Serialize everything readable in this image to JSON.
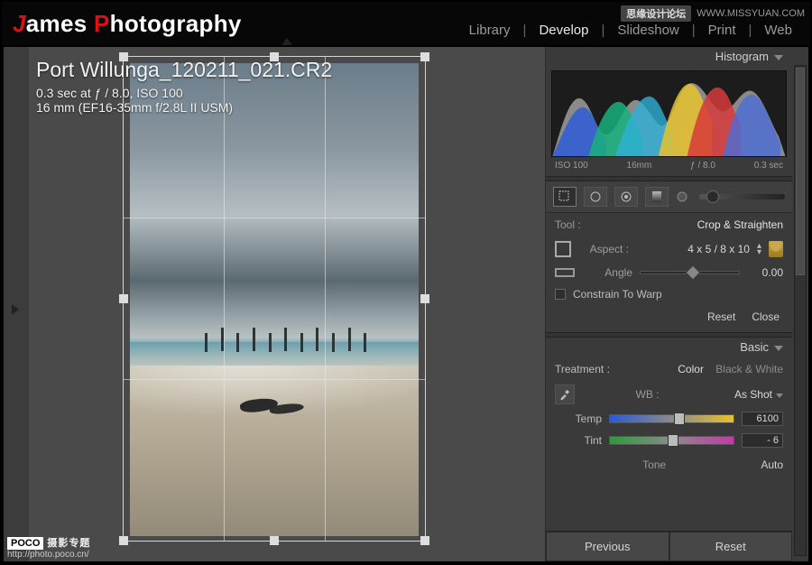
{
  "brand": {
    "pre": "ames ",
    "mid": "hotography"
  },
  "modules": {
    "library": "Library",
    "develop": "Develop",
    "slideshow": "Slideshow",
    "print": "Print",
    "web": "Web",
    "active": "develop"
  },
  "watermark_top": {
    "cn": "思缘设计论坛",
    "url": "WWW.MISSYUAN.COM"
  },
  "watermark_bottom": {
    "brand": "POCO",
    "cn": "摄影专题",
    "url": "http://photo.poco.cn/"
  },
  "image": {
    "filename": "Port Willunga_120211_021.CR2",
    "exposure_line": "0.3 sec at ƒ / 8.0, ISO 100",
    "lens_line": "16 mm (EF16-35mm f/2.8L II USM)"
  },
  "panels": {
    "histogram": {
      "title": "Histogram",
      "labels": {
        "iso": "ISO 100",
        "focal": "16mm",
        "aperture": "ƒ / 8.0",
        "shutter": "0.3 sec"
      }
    },
    "tool": {
      "label": "Tool :",
      "name": "Crop & Straighten",
      "aspect_label": "Aspect :",
      "aspect_value": "4 x 5  /  8 x 10",
      "angle_label": "Angle",
      "angle_value": "0.00",
      "constrain": "Constrain To Warp",
      "reset": "Reset",
      "close": "Close"
    },
    "basic": {
      "title": "Basic",
      "treatment_label": "Treatment :",
      "color": "Color",
      "bw": "Black & White",
      "wb_label": "WB :",
      "wb_value": "As Shot",
      "temp_label": "Temp",
      "temp_value": "6100",
      "tint_label": "Tint",
      "tint_value": "- 6",
      "tone_label": "Tone",
      "auto": "Auto"
    },
    "buttons": {
      "previous": "Previous",
      "reset": "Reset"
    }
  }
}
